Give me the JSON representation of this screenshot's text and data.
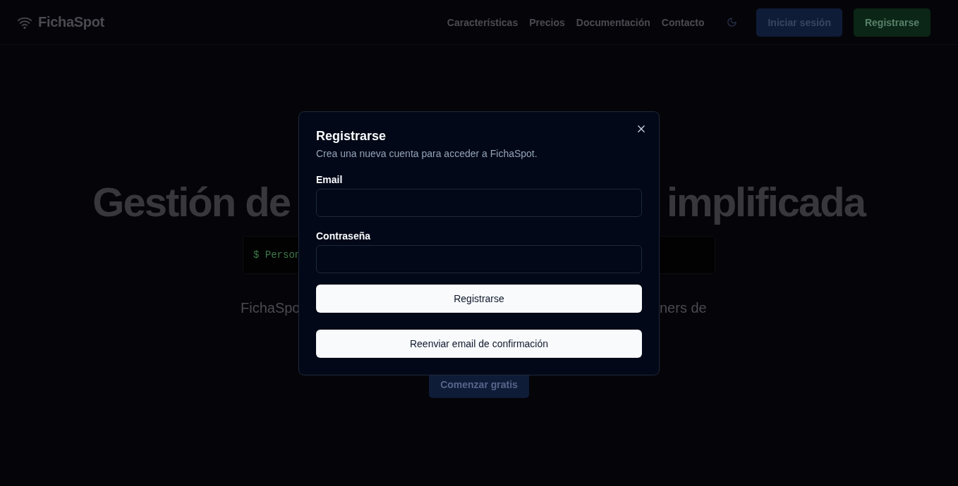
{
  "header": {
    "logo": "FichaSpot",
    "nav_links": [
      "Características",
      "Precios",
      "Documentación",
      "Contacto"
    ],
    "buttons": [
      {
        "label": "Iniciar sesión",
        "kind": "primary"
      },
      {
        "label": "Registrarse",
        "kind": "success"
      }
    ]
  },
  "hero": {
    "headline_left": "Gestión de",
    "headline_right": "implificada",
    "terminal_text": "$ Person",
    "description_left": "FichaSpo",
    "description_right": "ners de",
    "cta": "Comenzar gratis"
  },
  "dialog": {
    "title": "Registrarse",
    "description": "Crea una nueva cuenta para acceder a FichaSpot.",
    "fields": [
      {
        "label": "Email"
      },
      {
        "label": "Contraseña"
      }
    ],
    "buttons": [
      "Registrarse",
      "Reenviar email de confirmación"
    ]
  }
}
